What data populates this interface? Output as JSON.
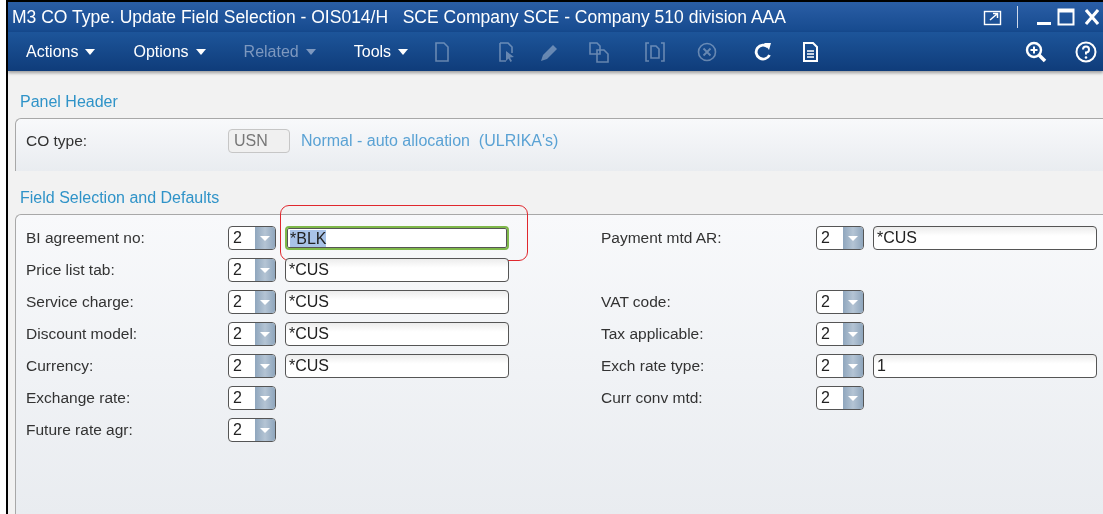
{
  "window": {
    "title": "M3 CO Type. Update Field Selection - OIS014/H   SCE Company SCE - Company 510 division AAA"
  },
  "menus": [
    {
      "label": "Actions",
      "disabled": false
    },
    {
      "label": "Options",
      "disabled": false
    },
    {
      "label": "Related",
      "disabled": true
    },
    {
      "label": "Tools",
      "disabled": false
    }
  ],
  "toolbar_icons": [
    {
      "kind": "new",
      "disabled": true
    },
    {
      "kind": "open",
      "disabled": true
    },
    {
      "kind": "edit",
      "disabled": true
    },
    {
      "kind": "copy",
      "disabled": true
    },
    {
      "kind": "display",
      "disabled": true
    },
    {
      "kind": "delete",
      "disabled": true
    },
    {
      "kind": "refresh",
      "disabled": false
    },
    {
      "kind": "page",
      "disabled": false
    }
  ],
  "panel_header": {
    "heading": "Panel Header",
    "label": "CO type:",
    "value": "USN",
    "disabled": true,
    "description": "Normal - auto allocation  (ULRIKA's)"
  },
  "field_selection": {
    "heading": "Field Selection and Defaults",
    "rows": [
      {
        "left": {
          "label": "BI agreement no:",
          "option": "2",
          "value": "*BLK",
          "focused": true,
          "annotated": true
        },
        "right": {
          "label": "Payment mtd AR:",
          "option": "2",
          "value": "*CUS",
          "focused": false,
          "annotated": false
        }
      },
      {
        "left": {
          "label": "Price list tab:",
          "option": "2",
          "value": "*CUS",
          "focused": false,
          "annotated": false
        }
      },
      {
        "left": {
          "label": "Service charge:",
          "option": "2",
          "value": "*CUS",
          "focused": false,
          "annotated": false
        },
        "right": {
          "label": "VAT code:",
          "option": "2"
        }
      },
      {
        "left": {
          "label": "Discount model:",
          "option": "2",
          "value": "*CUS",
          "focused": false,
          "annotated": false
        },
        "right": {
          "label": "Tax applicable:",
          "option": "2"
        }
      },
      {
        "left": {
          "label": "Currency:",
          "option": "2",
          "value": "*CUS",
          "focused": false,
          "annotated": false
        },
        "right": {
          "label": "Exch rate type:",
          "option": "2",
          "value": "1",
          "focused": false,
          "annotated": false
        }
      },
      {
        "left": {
          "label": "Exchange rate:",
          "option": "2"
        },
        "right": {
          "label": "Curr conv mtd:",
          "option": "2"
        }
      },
      {
        "left": {
          "label": "Future rate agr:",
          "option": "2"
        }
      }
    ]
  }
}
